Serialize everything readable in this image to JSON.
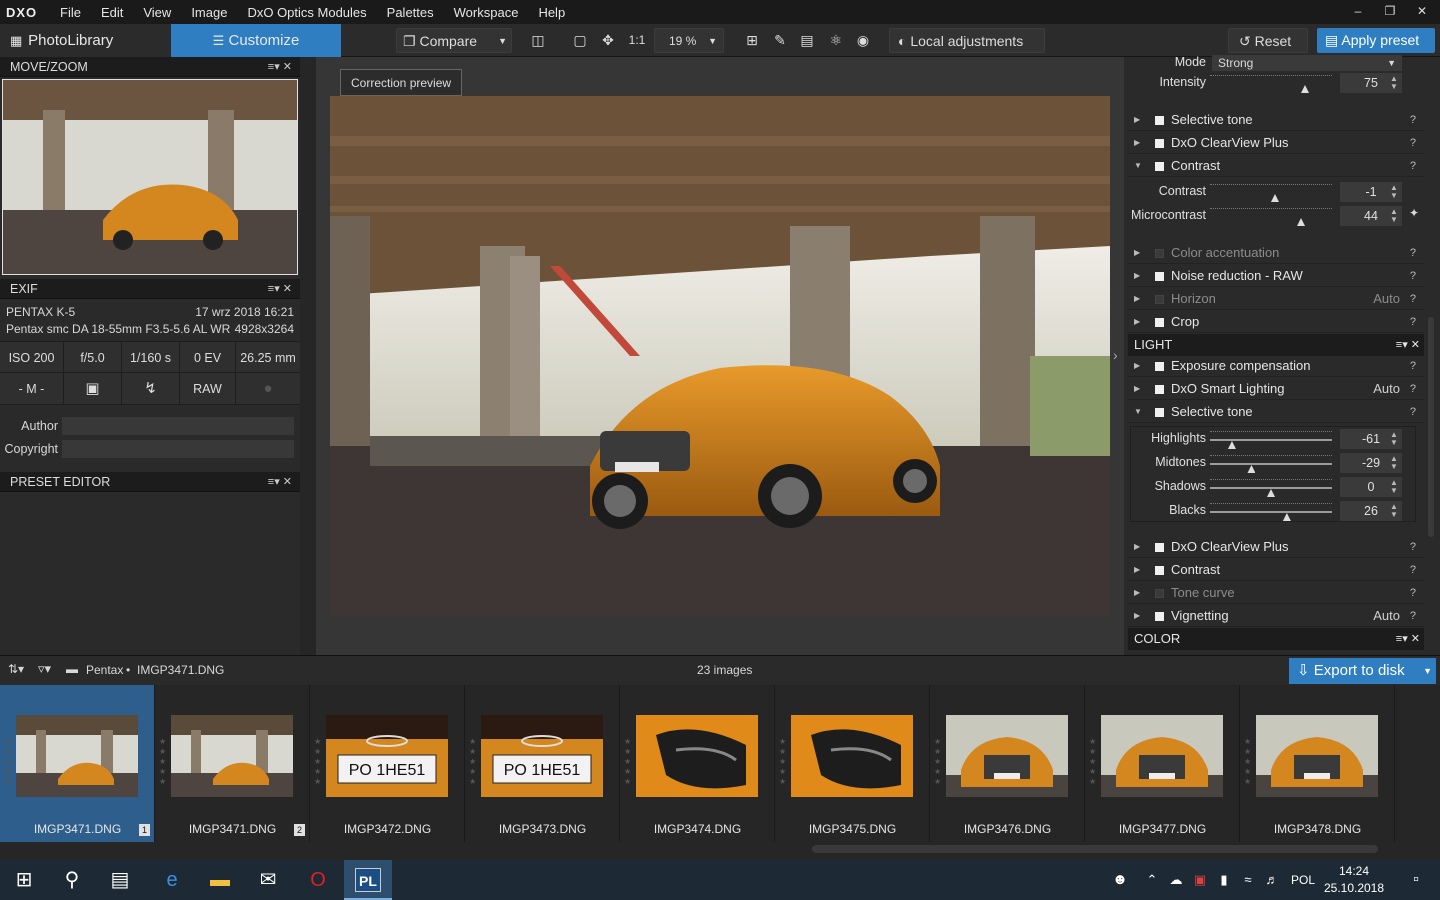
{
  "app": {
    "logo": "DXO",
    "menus": [
      "File",
      "Edit",
      "View",
      "Image",
      "DxO Optics Modules",
      "Palettes",
      "Workspace",
      "Help"
    ]
  },
  "toolbar": {
    "tab_photolibrary": "PhotoLibrary",
    "tab_customize": "Customize",
    "compare": "Compare",
    "zoom_1to1": "1:1",
    "zoom_value": "19 %",
    "local_adjustments": "Local adjustments",
    "reset": "Reset",
    "apply_preset": "Apply preset"
  },
  "left": {
    "movezoom_title": "MOVE/ZOOM",
    "exif_title": "EXIF",
    "camera": "PENTAX K-5",
    "datetime": "17 wrz 2018 16:21",
    "lens": "Pentax smc DA 18-55mm F3.5-5.6 AL WR",
    "dimensions": "4928x3264",
    "iso": "ISO 200",
    "aperture": "f/5.0",
    "shutter": "1/160 s",
    "ev": "0 EV",
    "focal": "26.25 mm",
    "mode": "- M -",
    "format": "RAW",
    "author_label": "Author",
    "copyright_label": "Copyright",
    "preset_editor_title": "PRESET EDITOR"
  },
  "center": {
    "correction_preview": "Correction preview"
  },
  "right": {
    "mode_label": "Mode",
    "mode_value": "Strong",
    "intensity_label": "Intensity",
    "intensity_value": "75",
    "items_top": [
      {
        "label": "Selective tone",
        "aux": "",
        "on": true
      },
      {
        "label": "DxO ClearView Plus",
        "aux": "",
        "on": true
      },
      {
        "label": "Contrast",
        "aux": "",
        "on": true,
        "open": true
      }
    ],
    "contrast_label": "Contrast",
    "contrast_value": "-1",
    "microcontrast_label": "Microcontrast",
    "microcontrast_value": "44",
    "items_mid": [
      {
        "label": "Color accentuation",
        "aux": "",
        "on": false
      },
      {
        "label": "Noise reduction - RAW",
        "aux": "",
        "on": true
      },
      {
        "label": "Horizon",
        "aux": "Auto",
        "on": false
      },
      {
        "label": "Crop",
        "aux": "",
        "on": true
      }
    ],
    "light_title": "LIGHT",
    "light_items": [
      {
        "label": "Exposure compensation",
        "aux": "",
        "on": true
      },
      {
        "label": "DxO Smart Lighting",
        "aux": "Auto",
        "on": true
      },
      {
        "label": "Selective tone",
        "aux": "",
        "on": true,
        "open": true
      }
    ],
    "tone_sliders": [
      {
        "label": "Highlights",
        "value": "-61",
        "pos": 0.18
      },
      {
        "label": "Midtones",
        "value": "-29",
        "pos": 0.34
      },
      {
        "label": "Shadows",
        "value": "0",
        "pos": 0.5
      },
      {
        "label": "Blacks",
        "value": "26",
        "pos": 0.63
      }
    ],
    "light_items_bottom": [
      {
        "label": "DxO ClearView Plus",
        "aux": "",
        "on": true
      },
      {
        "label": "Contrast",
        "aux": "",
        "on": true
      },
      {
        "label": "Tone curve",
        "aux": "",
        "on": false
      },
      {
        "label": "Vignetting",
        "aux": "Auto",
        "on": true
      }
    ],
    "color_title": "COLOR"
  },
  "filmbar": {
    "folder": "Pentax",
    "file": "IMGP3471.DNG",
    "count": "23 images",
    "export": "Export to disk"
  },
  "filmstrip": [
    {
      "name": "IMGP3471.DNG",
      "badge": "1",
      "kind": "scene"
    },
    {
      "name": "IMGP3471.DNG",
      "badge": "2",
      "kind": "scene"
    },
    {
      "name": "IMGP3472.DNG",
      "badge": "",
      "kind": "plate"
    },
    {
      "name": "IMGP3473.DNG",
      "badge": "",
      "kind": "plate"
    },
    {
      "name": "IMGP3474.DNG",
      "badge": "",
      "kind": "mirror"
    },
    {
      "name": "IMGP3475.DNG",
      "badge": "",
      "kind": "mirror"
    },
    {
      "name": "IMGP3476.DNG",
      "badge": "",
      "kind": "front"
    },
    {
      "name": "IMGP3477.DNG",
      "badge": "",
      "kind": "front"
    },
    {
      "name": "IMGP3478.DNG",
      "badge": "",
      "kind": "front"
    }
  ],
  "plate_text": "PO 1HE51",
  "taskbar": {
    "lang": "POL",
    "time": "14:24",
    "date": "25.10.2018",
    "pl_label": "PL"
  }
}
